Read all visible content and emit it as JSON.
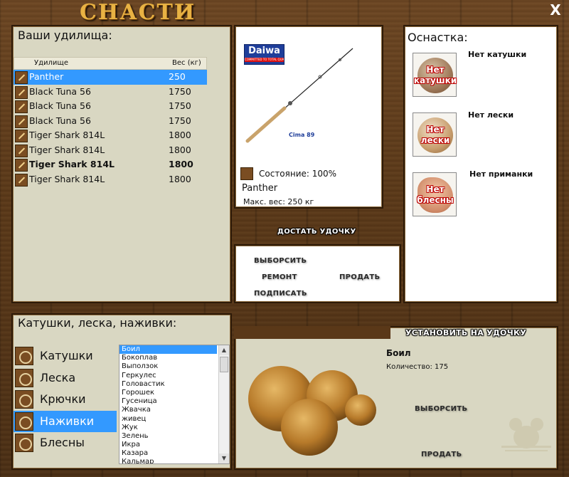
{
  "window": {
    "title": "СНАСТИ",
    "close_label": "X"
  },
  "rods": {
    "header": "Ваши удилища:",
    "col_name": "Удилище",
    "col_weight": "Вес (кг)",
    "rows": [
      {
        "name": "Panther",
        "weight": "250"
      },
      {
        "name": "Black Tuna 56",
        "weight": "1750"
      },
      {
        "name": "Black Tuna 56",
        "weight": "1750"
      },
      {
        "name": "Black Tuna 56",
        "weight": "1750"
      },
      {
        "name": "Tiger Shark 814L",
        "weight": "1800"
      },
      {
        "name": "Tiger Shark 814L",
        "weight": "1800"
      },
      {
        "name": "Tiger Shark 814L",
        "weight": "1800"
      },
      {
        "name": "Tiger Shark 814L",
        "weight": "1800"
      }
    ]
  },
  "rod_detail": {
    "brand": "Daiwa",
    "brand_tag": "COMMITTED TO TOTAL QUALITY",
    "model_tag": "Cima 89",
    "condition": "Состояние: 100%",
    "name": "Panther",
    "max_weight": "Макс. вес: 250 кг"
  },
  "rod_actions": {
    "take_out": "ДОСТАТЬ УДОЧКУ",
    "discard": "ВЫБОРСИТЬ",
    "repair": "РЕМОНТ",
    "sell": "ПРОДАТЬ",
    "sign": "ПОДПИСАТЬ"
  },
  "tackle": {
    "header": "Оснастка:",
    "reel": {
      "label": "Нет катушки",
      "badge": [
        "Нет",
        "катушки"
      ]
    },
    "line": {
      "label": "Нет лески",
      "badge": [
        "Нет",
        "лески"
      ]
    },
    "lure": {
      "label": "Нет приманки",
      "badge": [
        "Нет",
        "блесны"
      ]
    }
  },
  "categories": {
    "header": "Катушки, леска, наживки:",
    "items": [
      "Катушки",
      "Леска",
      "Крючки",
      "Наживки",
      "Блесны"
    ],
    "selected_index": 3
  },
  "baits": {
    "items": [
      "Боил",
      "Бокоплав",
      "Выползок",
      "Геркулес",
      "Головастик",
      "Горошек",
      "Гусеница",
      "Жвачка",
      "живец",
      "Жук",
      "Зелень",
      "Икра",
      "Казара",
      "Кальмар"
    ],
    "selected_index": 0
  },
  "bait_detail": {
    "install": "УСТАНОВИТЬ НА УДОЧКУ",
    "name": "Боил",
    "quantity": "Количество: 175",
    "discard": "ВЫБОРСИТЬ",
    "sell": "ПРОДАТЬ"
  },
  "colors": {
    "selection": "#3399ff",
    "title": "#e8b243",
    "panel_olive": "#d9d7c2"
  }
}
